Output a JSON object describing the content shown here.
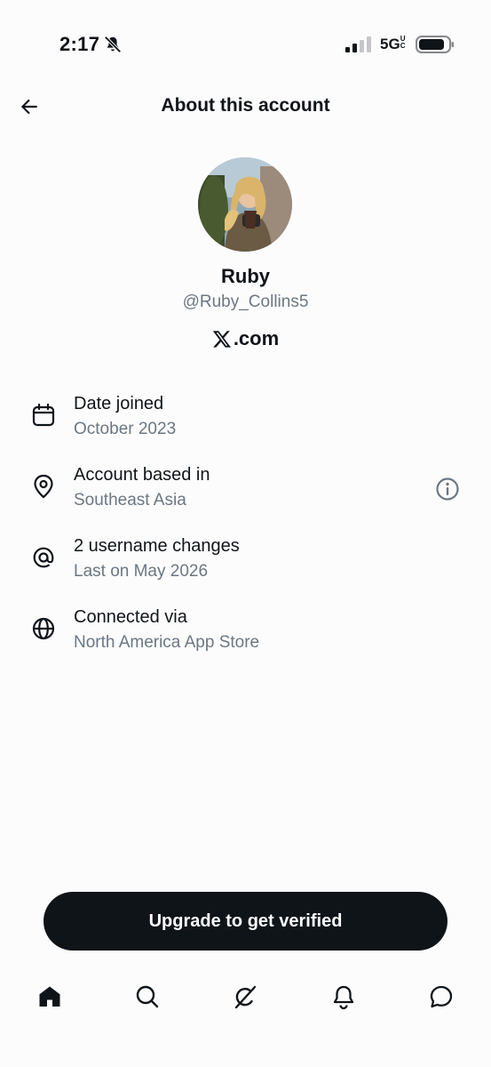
{
  "status_bar": {
    "time": "2:17",
    "network": "5G",
    "network_suffix": "UC"
  },
  "header": {
    "title": "About this account"
  },
  "profile": {
    "name": "Ruby",
    "handle": "@Ruby_Collins5",
    "site": ".com"
  },
  "details": [
    {
      "title": "Date joined",
      "value": "October 2023",
      "icon": "calendar-icon"
    },
    {
      "title": "Account based in",
      "value": "Southeast Asia",
      "icon": "location-pin-icon"
    },
    {
      "title": "2 username changes",
      "value": "Last on May 2026",
      "icon": "at-sign-icon"
    },
    {
      "title": "Connected via",
      "value": "North America App Store",
      "icon": "globe-icon"
    }
  ],
  "cta": {
    "label": "Upgrade to get verified"
  },
  "tabs": [
    {
      "name": "home",
      "icon": "home-icon",
      "active": true
    },
    {
      "name": "search",
      "icon": "search-icon"
    },
    {
      "name": "grok",
      "icon": "grok-icon"
    },
    {
      "name": "notifications",
      "icon": "bell-icon"
    },
    {
      "name": "messages",
      "icon": "message-icon"
    }
  ],
  "colors": {
    "text": "#0f1419",
    "secondary": "#6b7782",
    "background": "#fdfcfd",
    "button": "#0f1419"
  }
}
